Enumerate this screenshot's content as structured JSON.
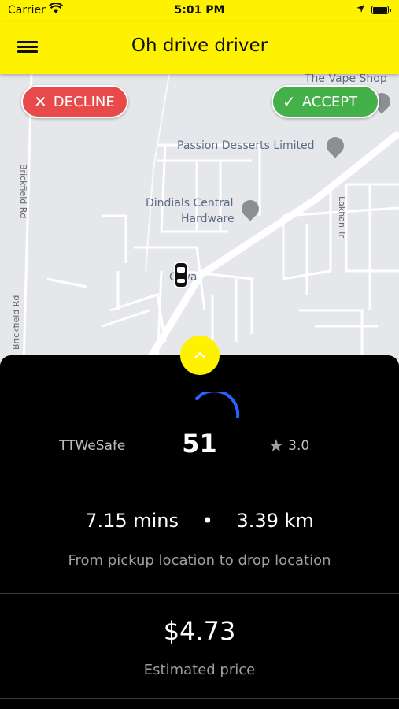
{
  "status_bar": {
    "carrier": "Carrier",
    "time": "5:01 PM"
  },
  "header": {
    "title": "Oh drive driver",
    "menu_icon": "hamburger-menu-icon"
  },
  "map": {
    "labels": {
      "vape_shop": "The Vape Shop",
      "passion_desserts": "Passion Desserts Limited",
      "dindials_line1": "Dindials Central",
      "dindials_line2": "Hardware",
      "brickfield_top": "Brickfield Rd",
      "brickfield_bottom": "Brickfield Rd",
      "lakhan": "Lakhan Tr",
      "chaguanas": "Cuva"
    }
  },
  "actions": {
    "decline": "DECLINE",
    "accept": "ACCEPT"
  },
  "request": {
    "company": "TTWeSafe",
    "countdown": "51",
    "rating": "3.0",
    "duration": "7.15 mins",
    "separator": "•",
    "distance": "3.39 km",
    "trip_caption": "From pickup location to drop location",
    "price": "$4.73",
    "price_caption": "Estimated price"
  },
  "colors": {
    "brand_yellow": "#fff200",
    "decline_red": "#e84a4a",
    "accept_green": "#44b04a",
    "spinner_blue": "#2962ff"
  }
}
